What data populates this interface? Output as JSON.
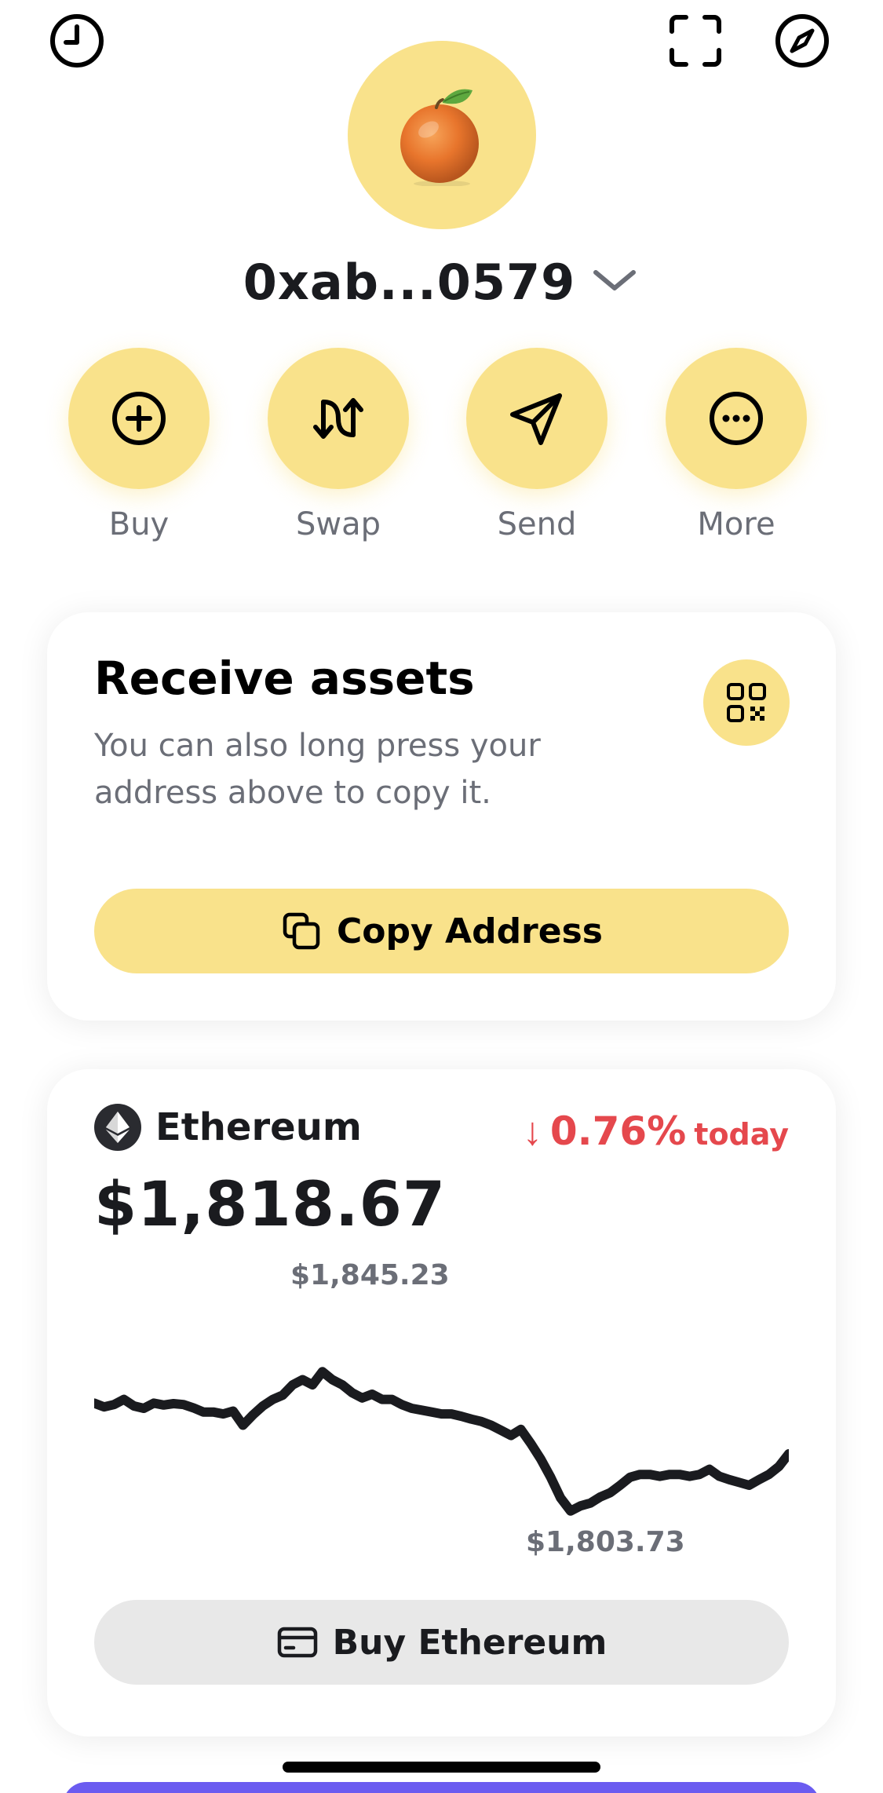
{
  "top_bar": {
    "left_icon": "clock-icon",
    "right_icons": [
      "scan-icon",
      "compass-icon"
    ]
  },
  "avatar": {
    "icon": "tangerine-icon",
    "bg_color": "#f9e28b"
  },
  "account": {
    "address": "0xab...0579",
    "chevron": "chevron-down-icon"
  },
  "actions": [
    {
      "label": "Buy",
      "icon": "plus-circle-icon"
    },
    {
      "label": "Swap",
      "icon": "swap-icon"
    },
    {
      "label": "Send",
      "icon": "send-icon"
    },
    {
      "label": "More",
      "icon": "more-icon"
    }
  ],
  "receive_card": {
    "title": "Receive assets",
    "description": "You can also long press your address above to copy it.",
    "qr_icon": "qr-code-icon",
    "copy_button": {
      "label": "Copy Address",
      "icon": "copy-icon"
    }
  },
  "eth_card": {
    "name": "Ethereum",
    "icon": "ethereum-icon",
    "change": {
      "arrow": "↓",
      "value": "0.76%",
      "suffix": "today",
      "color": "#e5484d"
    },
    "price": "$1,818.67",
    "chart_data": {
      "type": "line",
      "high_label": "$1,845.23",
      "low_label": "$1,803.73",
      "ylim": [
        1803.73,
        1845.23
      ],
      "values": [
        1828.6,
        1827.8,
        1828.3,
        1829.4,
        1828.0,
        1827.5,
        1828.6,
        1828.2,
        1828.5,
        1828.3,
        1827.6,
        1826.7,
        1826.7,
        1826.3,
        1826.9,
        1823.9,
        1826.1,
        1828.0,
        1829.4,
        1830.3,
        1832.5,
        1833.6,
        1832.5,
        1835.3,
        1833.6,
        1832.5,
        1830.8,
        1829.7,
        1830.5,
        1829.4,
        1829.4,
        1828.3,
        1827.5,
        1827.1,
        1826.7,
        1826.3,
        1826.3,
        1825.8,
        1825.2,
        1824.7,
        1823.9,
        1822.8,
        1821.7,
        1823.0,
        1820.0,
        1816.7,
        1812.8,
        1808.4,
        1805.6,
        1806.7,
        1807.3,
        1808.6,
        1809.5,
        1811.1,
        1812.8,
        1813.4,
        1813.4,
        1813.0,
        1813.4,
        1813.4,
        1813.0,
        1813.4,
        1814.5,
        1813.0,
        1812.3,
        1811.7,
        1811.1,
        1812.3,
        1813.4,
        1815.1,
        1817.8
      ]
    }
  },
  "buy_eth_button": {
    "label": "Buy Ethereum",
    "icon": "card-icon"
  },
  "colors": {
    "accent_yellow": "#f9e28b",
    "text_primary": "#1a1b1f",
    "text_secondary": "#6b6e77",
    "negative": "#e5484d",
    "button_gray": "#e8e8e8",
    "bottom_peek": "#6b5cf0"
  }
}
